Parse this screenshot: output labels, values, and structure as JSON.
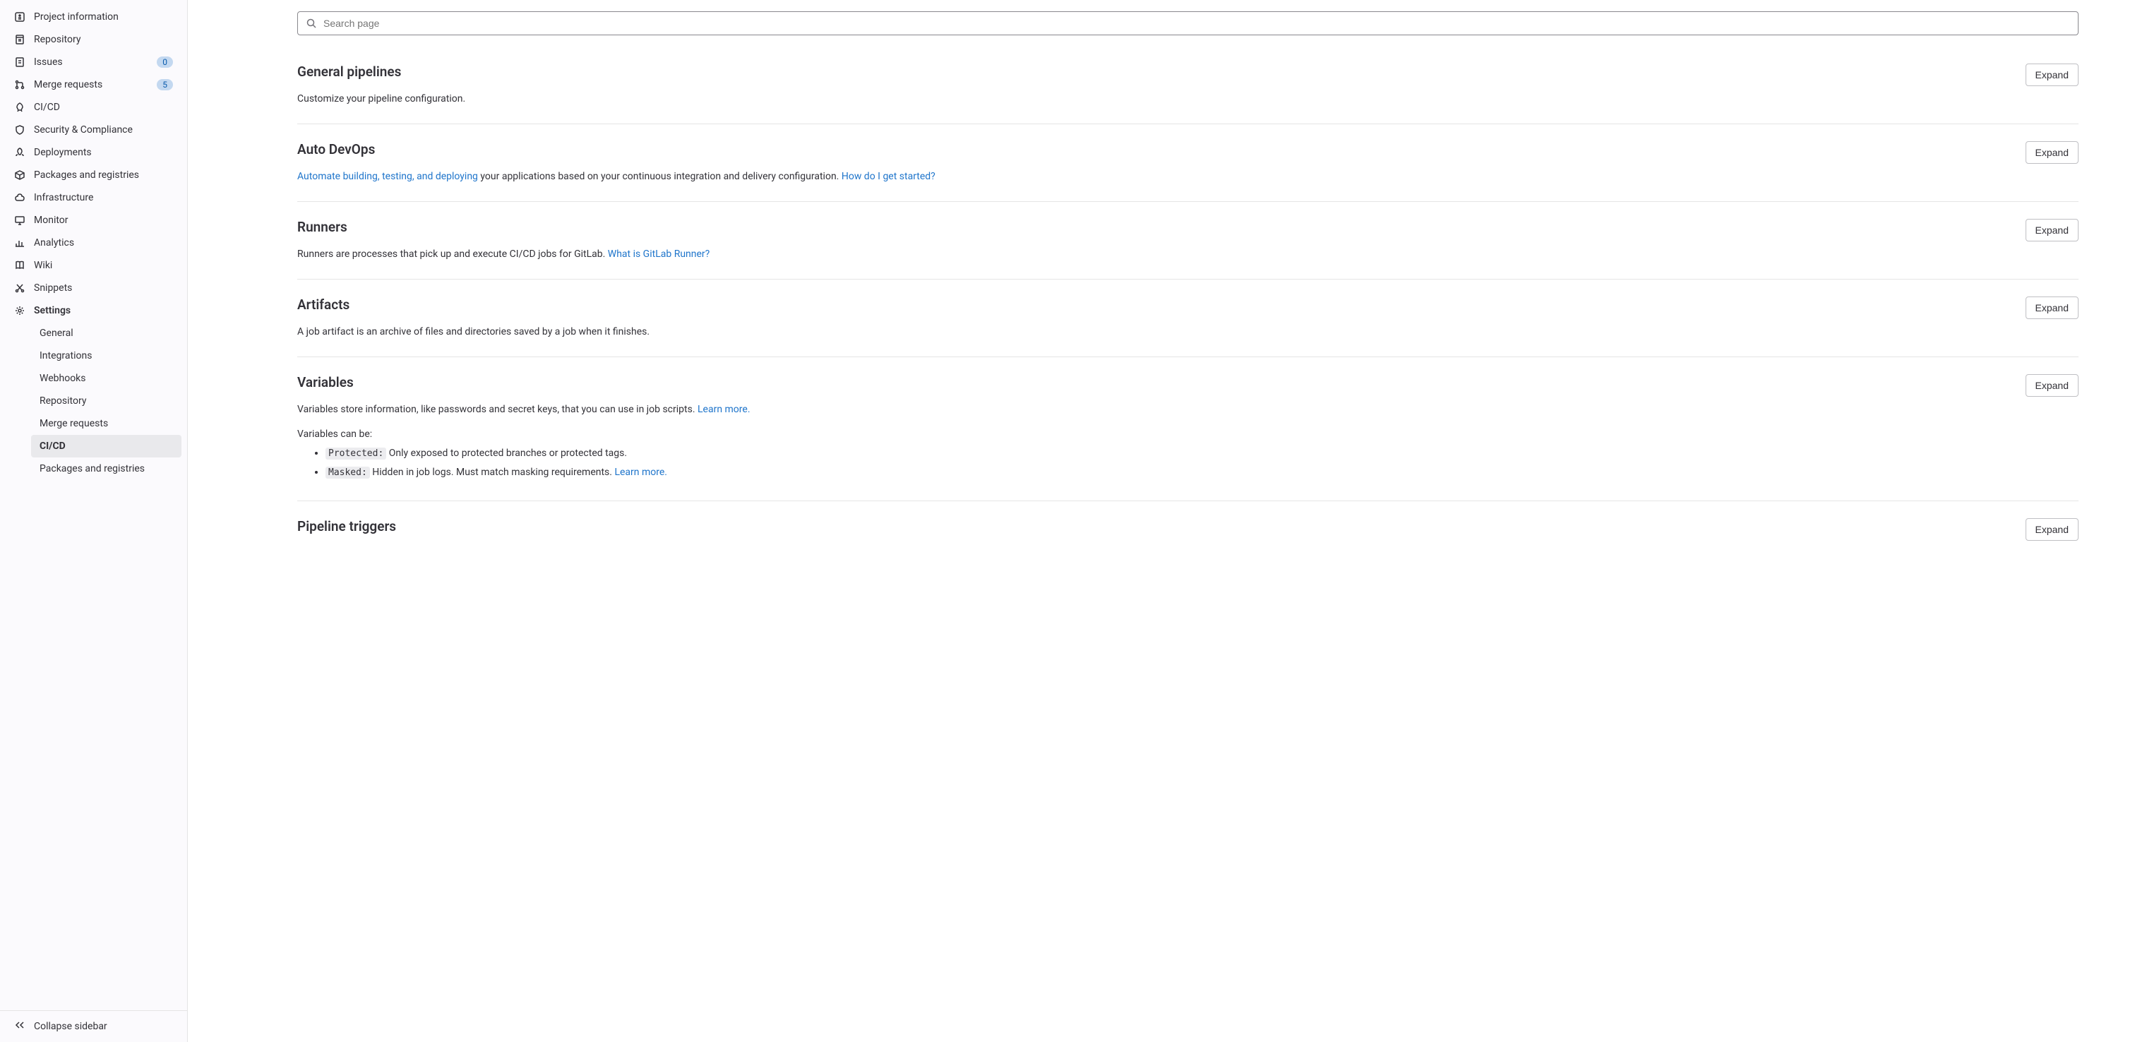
{
  "sidebar": {
    "items": [
      {
        "label": "Project information"
      },
      {
        "label": "Repository"
      },
      {
        "label": "Issues",
        "badge": "0"
      },
      {
        "label": "Merge requests",
        "badge": "5"
      },
      {
        "label": "CI/CD"
      },
      {
        "label": "Security & Compliance"
      },
      {
        "label": "Deployments"
      },
      {
        "label": "Packages and registries"
      },
      {
        "label": "Infrastructure"
      },
      {
        "label": "Monitor"
      },
      {
        "label": "Analytics"
      },
      {
        "label": "Wiki"
      },
      {
        "label": "Snippets"
      },
      {
        "label": "Settings"
      }
    ],
    "settings_sub": [
      {
        "label": "General"
      },
      {
        "label": "Integrations"
      },
      {
        "label": "Webhooks"
      },
      {
        "label": "Repository"
      },
      {
        "label": "Merge requests"
      },
      {
        "label": "CI/CD"
      },
      {
        "label": "Packages and registries"
      }
    ],
    "collapse_label": "Collapse sidebar"
  },
  "search": {
    "placeholder": "Search page"
  },
  "sections": {
    "general_pipelines": {
      "title": "General pipelines",
      "desc": "Customize your pipeline configuration.",
      "expand": "Expand"
    },
    "auto_devops": {
      "title": "Auto DevOps",
      "link1": "Automate building, testing, and deploying",
      "desc_mid": " your applications based on your continuous integration and delivery configuration. ",
      "link2": "How do I get started?",
      "expand": "Expand"
    },
    "runners": {
      "title": "Runners",
      "desc": "Runners are processes that pick up and execute CI/CD jobs for GitLab. ",
      "link": "What is GitLab Runner?",
      "expand": "Expand"
    },
    "artifacts": {
      "title": "Artifacts",
      "desc": "A job artifact is an archive of files and directories saved by a job when it finishes.",
      "expand": "Expand"
    },
    "variables": {
      "title": "Variables",
      "desc": "Variables store information, like passwords and secret keys, that you can use in job scripts. ",
      "link": "Learn more.",
      "can_be": "Variables can be:",
      "protected_code": "Protected:",
      "protected_desc": " Only exposed to protected branches or protected tags.",
      "masked_code": "Masked:",
      "masked_desc": " Hidden in job logs. Must match masking requirements. ",
      "masked_link": "Learn more.",
      "expand": "Expand"
    },
    "pipeline_triggers": {
      "title": "Pipeline triggers",
      "expand": "Expand"
    }
  }
}
